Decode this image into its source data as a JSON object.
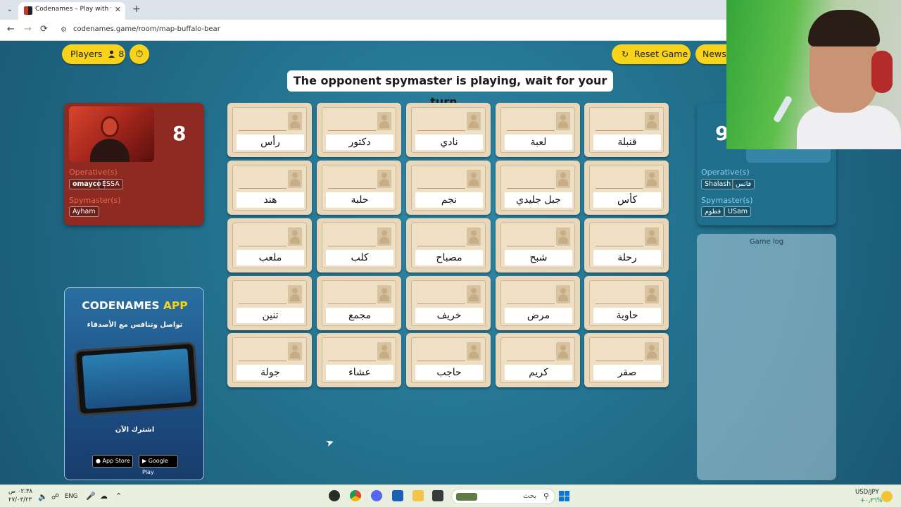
{
  "browser": {
    "tab_title": "Codenames – Play with your Fr",
    "tab_close": "✕",
    "new_tab": "+",
    "tab_menu": "⌄",
    "url": "codenames.game/room/map-buffalo-bear",
    "nav": {
      "back": "←",
      "forward": "→",
      "reload": "⟳",
      "site_info": "⚙"
    }
  },
  "toolbar": {
    "players_label": "Players",
    "players_icon": "person-icon",
    "players_count": "8",
    "timer_icon": "⏱",
    "reset_icon": "↻",
    "reset_label": "Reset Game",
    "news_label": "News"
  },
  "status_message": "The opponent spymaster is playing, wait for your turn...",
  "red_team": {
    "color": "#8e2a22",
    "score": "8",
    "operatives_label": "Operative(s)",
    "operatives": [
      "omayco",
      "ESSA"
    ],
    "spymasters_label": "Spymaster(s)",
    "spymasters": [
      "Ayham"
    ]
  },
  "blue_team": {
    "color": "#1e6e8c",
    "score": "9",
    "operatives_label": "Operative(s)",
    "operatives": [
      "Shalash",
      "فاتس"
    ],
    "spymasters_label": "Spymaster(s)",
    "spymasters": [
      "فطوم",
      "USam"
    ]
  },
  "game_log": {
    "title": "Game log"
  },
  "ad": {
    "title_main": "CODENAMES",
    "title_accent": "APP",
    "subtitle": "تواصل وتنافس مع الأصدقاء",
    "cta": "اشترك الآن",
    "app_store": "App Store",
    "google_play": "Google Play"
  },
  "cards": [
    [
      "رأس",
      "دكتور",
      "نادي",
      "لعبة",
      "قنبلة"
    ],
    [
      "هند",
      "حلبة",
      "نجم",
      "جبل جليدي",
      "كأس"
    ],
    [
      "ملعب",
      "كلب",
      "مصباح",
      "شبح",
      "رحلة"
    ],
    [
      "تنين",
      "مجمع",
      "خريف",
      "مرض",
      "حاوية"
    ],
    [
      "جولة",
      "عشاء",
      "حاجب",
      "كريم",
      "صقر"
    ]
  ],
  "taskbar": {
    "time": "٠٢:٣٨ ص",
    "date": "٢٧/٠٣/٢٣",
    "language": "ENG",
    "search_placeholder": "بحث",
    "currency_pair": "USD/JPY",
    "currency_change": "+٠٫٣٦%"
  }
}
